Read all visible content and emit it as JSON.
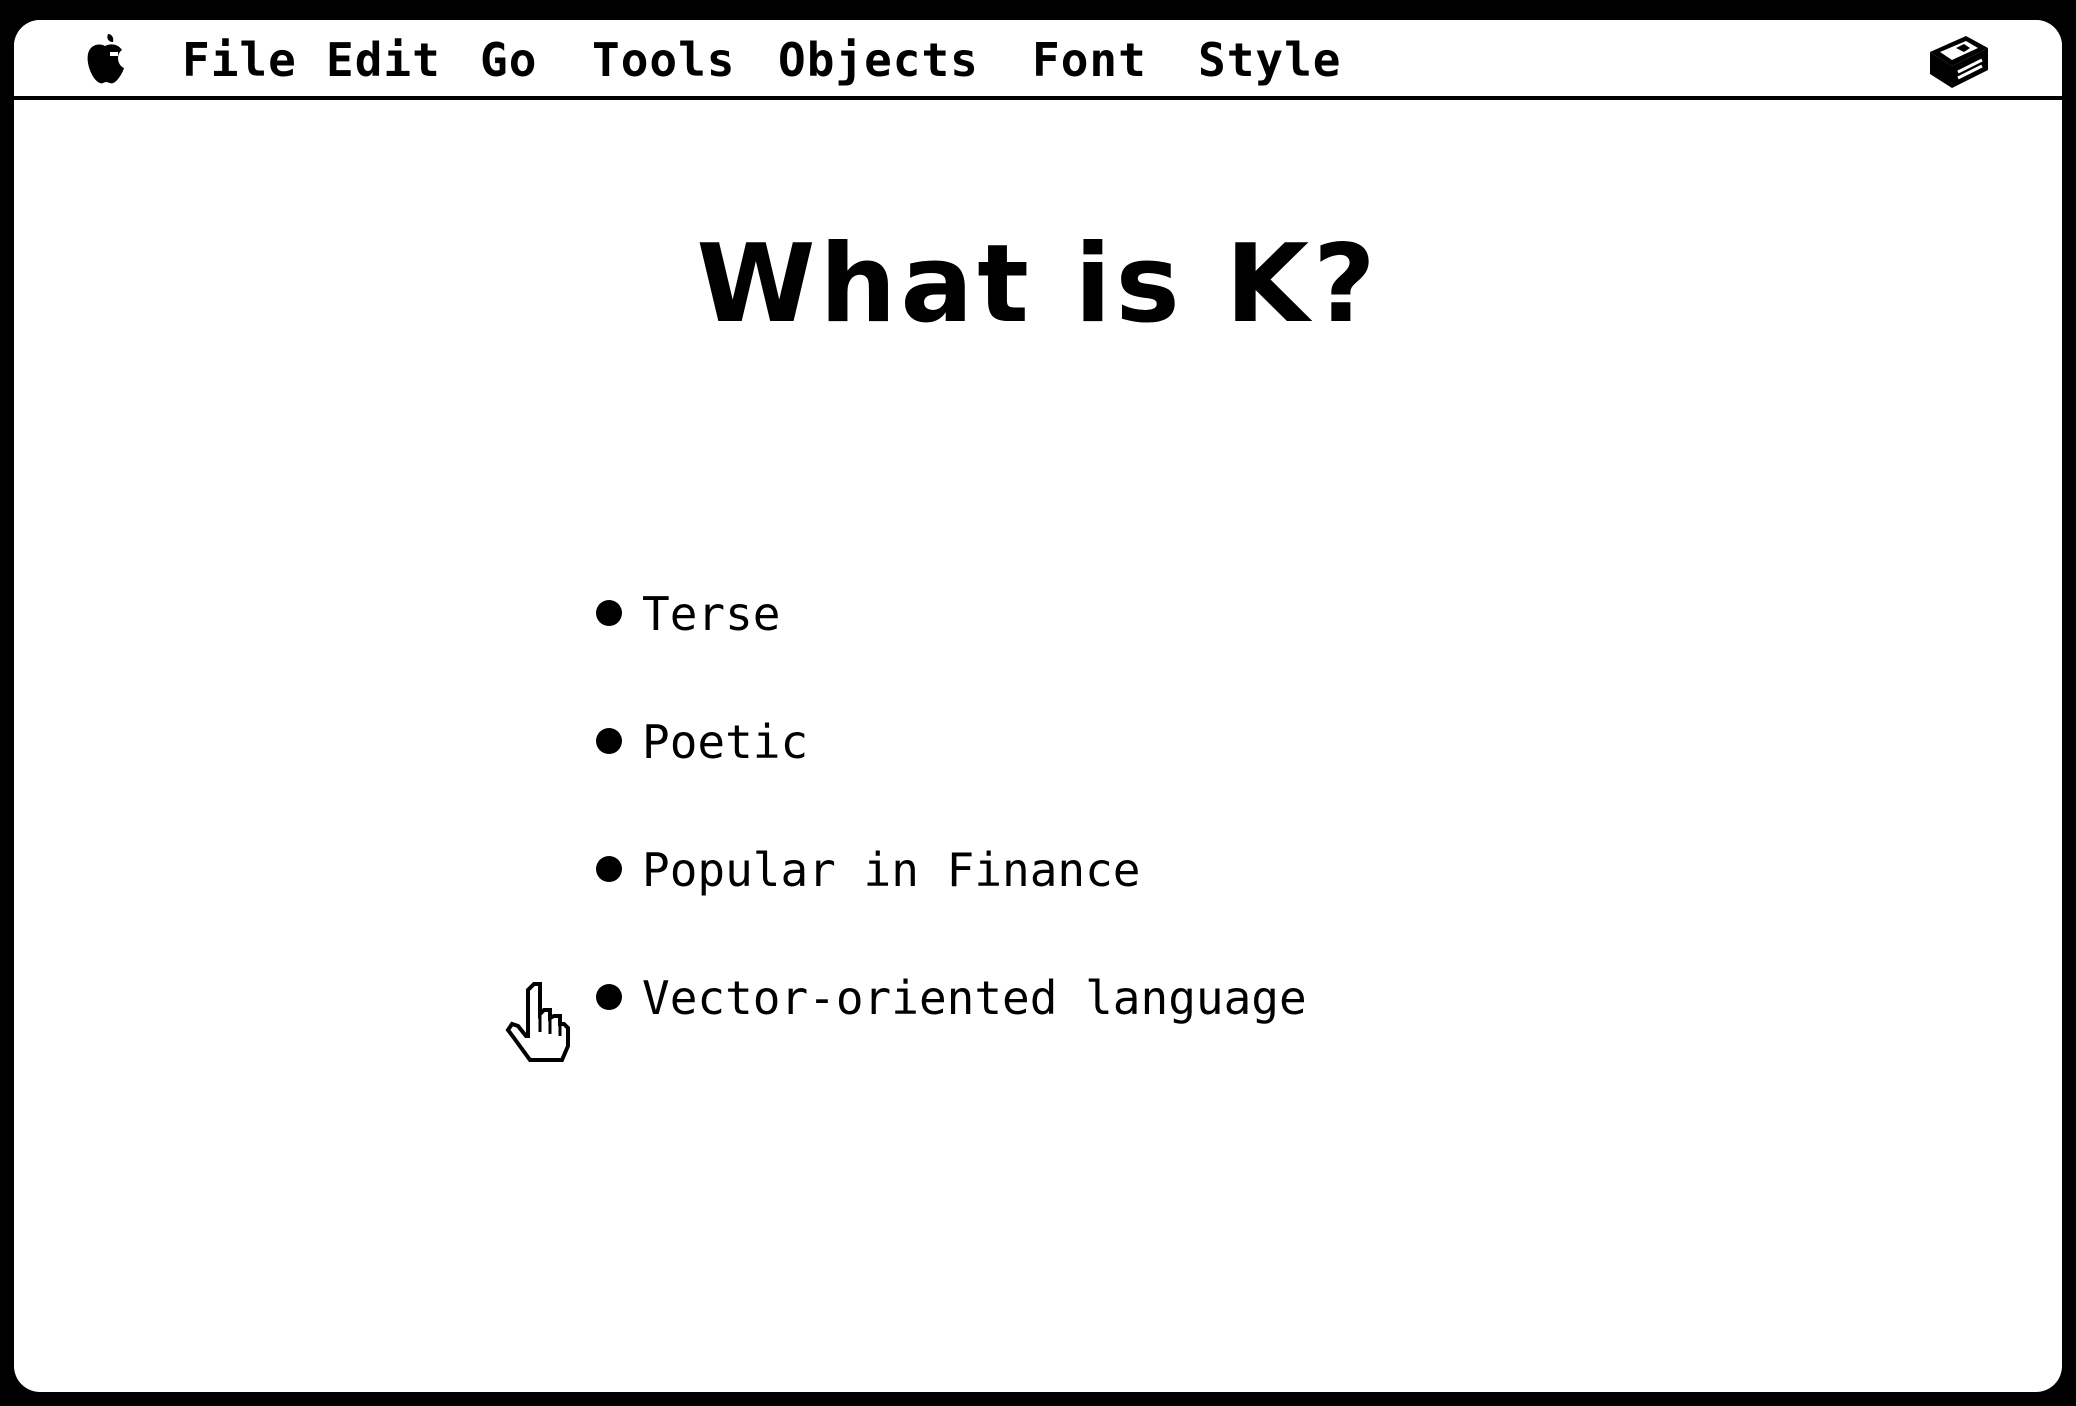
{
  "menubar": {
    "apple_icon": "apple-logo-icon",
    "items": [
      "File",
      "Edit",
      "Go",
      "Tools",
      "Objects",
      "Font",
      "Style"
    ],
    "right_icon": "hypercard-stack-icon"
  },
  "card": {
    "title": "What is K?",
    "bullets": [
      "Terse",
      "Poetic",
      "Popular in Finance",
      "Vector-oriented language"
    ]
  },
  "cursor": {
    "icon": "browse-hand-cursor-icon"
  }
}
